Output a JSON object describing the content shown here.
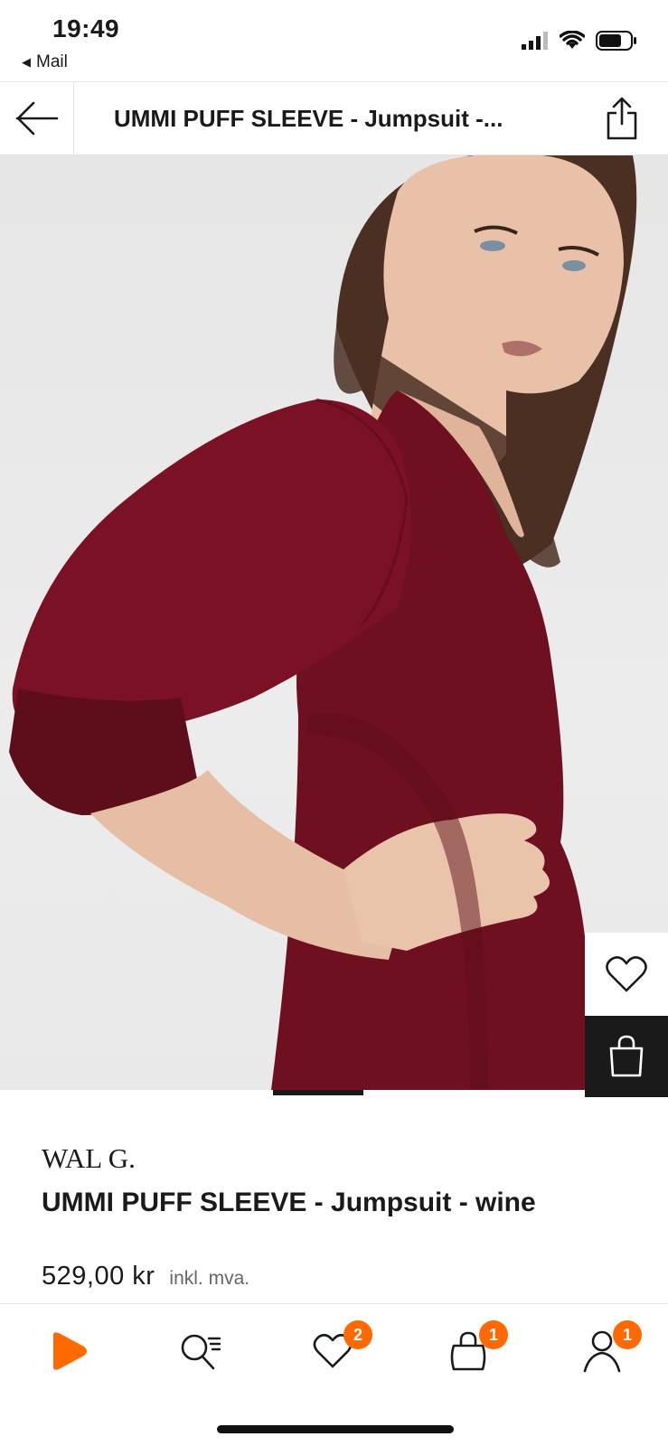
{
  "status_bar": {
    "time": "19:49",
    "back_app": "Mail",
    "icons": [
      "cellular-signal-icon",
      "wifi-icon",
      "battery-icon"
    ]
  },
  "header": {
    "title": "UMMI PUFF SLEEVE - Jumpsuit -...",
    "back_icon": "arrow-left-icon",
    "share_icon": "share-icon"
  },
  "image": {
    "description_icon": "product-photo",
    "carousel_count": 4,
    "carousel_active_index": 1
  },
  "side_actions": {
    "wishlist_icon": "heart-icon",
    "bag_icon": "shopping-bag-icon"
  },
  "product": {
    "brand": "WAL G.",
    "name": "UMMI PUFF SLEEVE - Jumpsuit - wine",
    "price": "529,00 kr",
    "vat_note": "inkl. mva."
  },
  "tab_bar": {
    "tabs": [
      {
        "name": "home",
        "icon": "play-logo-icon",
        "badge": ""
      },
      {
        "name": "search",
        "icon": "search-icon",
        "badge": ""
      },
      {
        "name": "wishlist",
        "icon": "heart-icon",
        "badge": "2"
      },
      {
        "name": "bag",
        "icon": "bag-icon",
        "badge": "1"
      },
      {
        "name": "account",
        "icon": "user-icon",
        "badge": "1"
      }
    ]
  },
  "colors": {
    "accent": "#ff6900",
    "dress": "#6e1020",
    "text": "#1a1a1a"
  }
}
